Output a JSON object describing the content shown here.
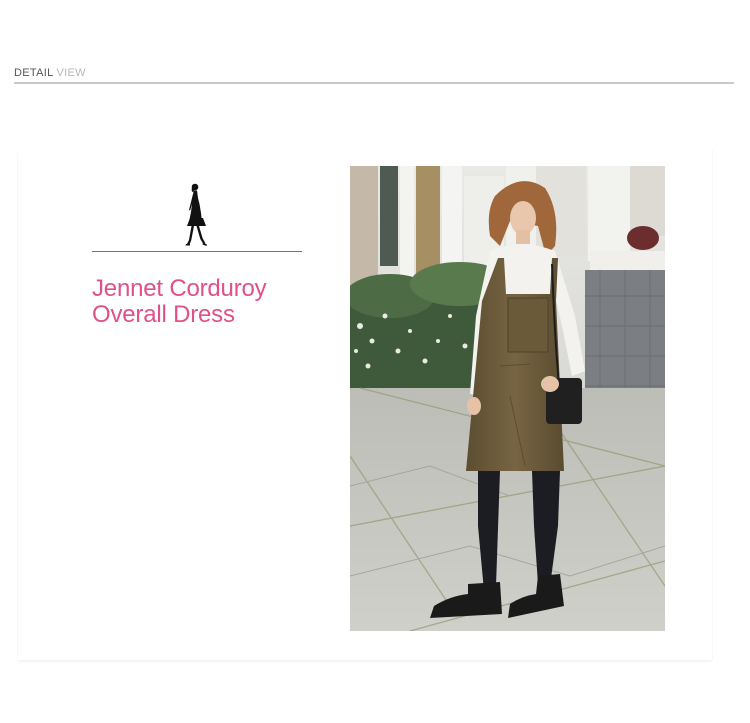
{
  "header": {
    "title_primary": "DETAIL",
    "title_secondary": "VIEW"
  },
  "product": {
    "title_line1": "Jennet Corduroy",
    "title_line2": "Overall Dress"
  },
  "icons": {
    "walker": "walking-woman-silhouette-icon"
  },
  "colors": {
    "accent": "#e0508a",
    "rule": "#d8417a",
    "dress": "#6e5e3c"
  }
}
